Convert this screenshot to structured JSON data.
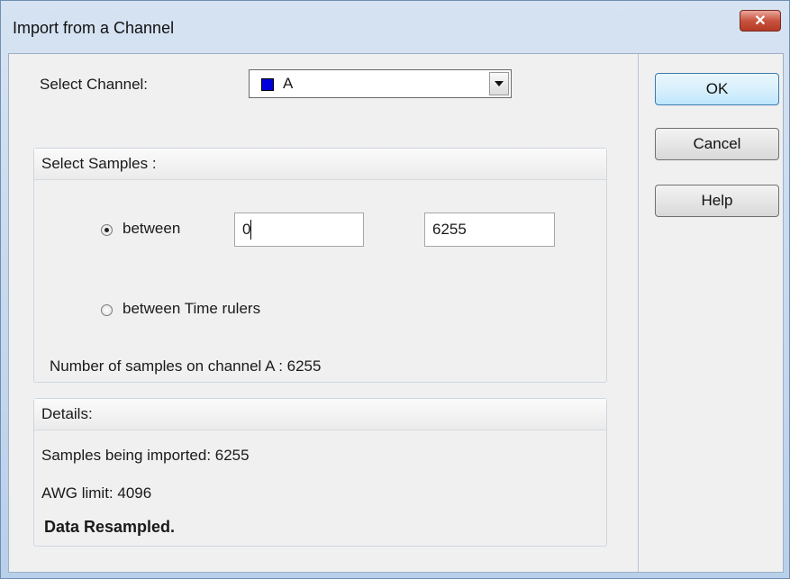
{
  "window": {
    "title": "Import from a Channel",
    "close_label": "✕"
  },
  "channel": {
    "label": "Select Channel:",
    "value": "A",
    "swatch_color": "#0000dd"
  },
  "samples": {
    "header": "Select Samples :",
    "option_between_label": "between",
    "option_between_selected": true,
    "from_value": "0",
    "to_value": "6255",
    "option_time_rulers_label": "between Time rulers",
    "count_text": "Number of samples on channel A : 6255"
  },
  "details": {
    "header": "Details:",
    "imported_text": "Samples being imported: 6255",
    "limit_text": "AWG limit: 4096",
    "status_text": "Data Resampled."
  },
  "buttons": {
    "ok": "OK",
    "cancel": "Cancel",
    "help": "Help"
  }
}
